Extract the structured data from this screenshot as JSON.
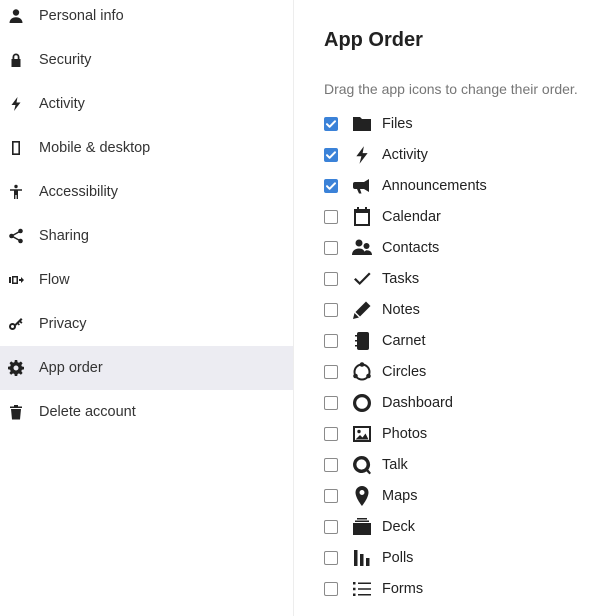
{
  "sidebar": {
    "items": [
      {
        "label": "Personal info",
        "icon": "person-icon",
        "active": false
      },
      {
        "label": "Security",
        "icon": "lock-icon",
        "active": false
      },
      {
        "label": "Activity",
        "icon": "lightning-icon",
        "active": false
      },
      {
        "label": "Mobile & desktop",
        "icon": "phone-icon",
        "active": false
      },
      {
        "label": "Accessibility",
        "icon": "accessibility-icon",
        "active": false
      },
      {
        "label": "Sharing",
        "icon": "share-icon",
        "active": false
      },
      {
        "label": "Flow",
        "icon": "flow-icon",
        "active": false
      },
      {
        "label": "Privacy",
        "icon": "key-icon",
        "active": false
      },
      {
        "label": "App order",
        "icon": "gear-icon",
        "active": true
      },
      {
        "label": "Delete account",
        "icon": "trash-icon",
        "active": false
      }
    ]
  },
  "main": {
    "title": "App Order",
    "hint": "Drag the app icons to change their order.",
    "apps": [
      {
        "label": "Files",
        "icon": "folder-icon",
        "checked": true
      },
      {
        "label": "Activity",
        "icon": "lightning-icon",
        "checked": true
      },
      {
        "label": "Announcements",
        "icon": "megaphone-icon",
        "checked": true
      },
      {
        "label": "Calendar",
        "icon": "calendar-icon",
        "checked": false
      },
      {
        "label": "Contacts",
        "icon": "contacts-icon",
        "checked": false
      },
      {
        "label": "Tasks",
        "icon": "checkmark-icon",
        "checked": false
      },
      {
        "label": "Notes",
        "icon": "pencil-icon",
        "checked": false
      },
      {
        "label": "Carnet",
        "icon": "notebook-icon",
        "checked": false
      },
      {
        "label": "Circles",
        "icon": "circles-icon",
        "checked": false
      },
      {
        "label": "Dashboard",
        "icon": "ring-icon",
        "checked": false
      },
      {
        "label": "Photos",
        "icon": "image-icon",
        "checked": false
      },
      {
        "label": "Talk",
        "icon": "talk-icon",
        "checked": false
      },
      {
        "label": "Maps",
        "icon": "map-pin-icon",
        "checked": false
      },
      {
        "label": "Deck",
        "icon": "deck-icon",
        "checked": false
      },
      {
        "label": "Polls",
        "icon": "poll-icon",
        "checked": false
      },
      {
        "label": "Forms",
        "icon": "list-icon",
        "checked": false
      }
    ]
  },
  "colors": {
    "checkbox_checked": "#3b82d8",
    "active_item_bg": "#ececf2",
    "hint_text": "#767676"
  }
}
